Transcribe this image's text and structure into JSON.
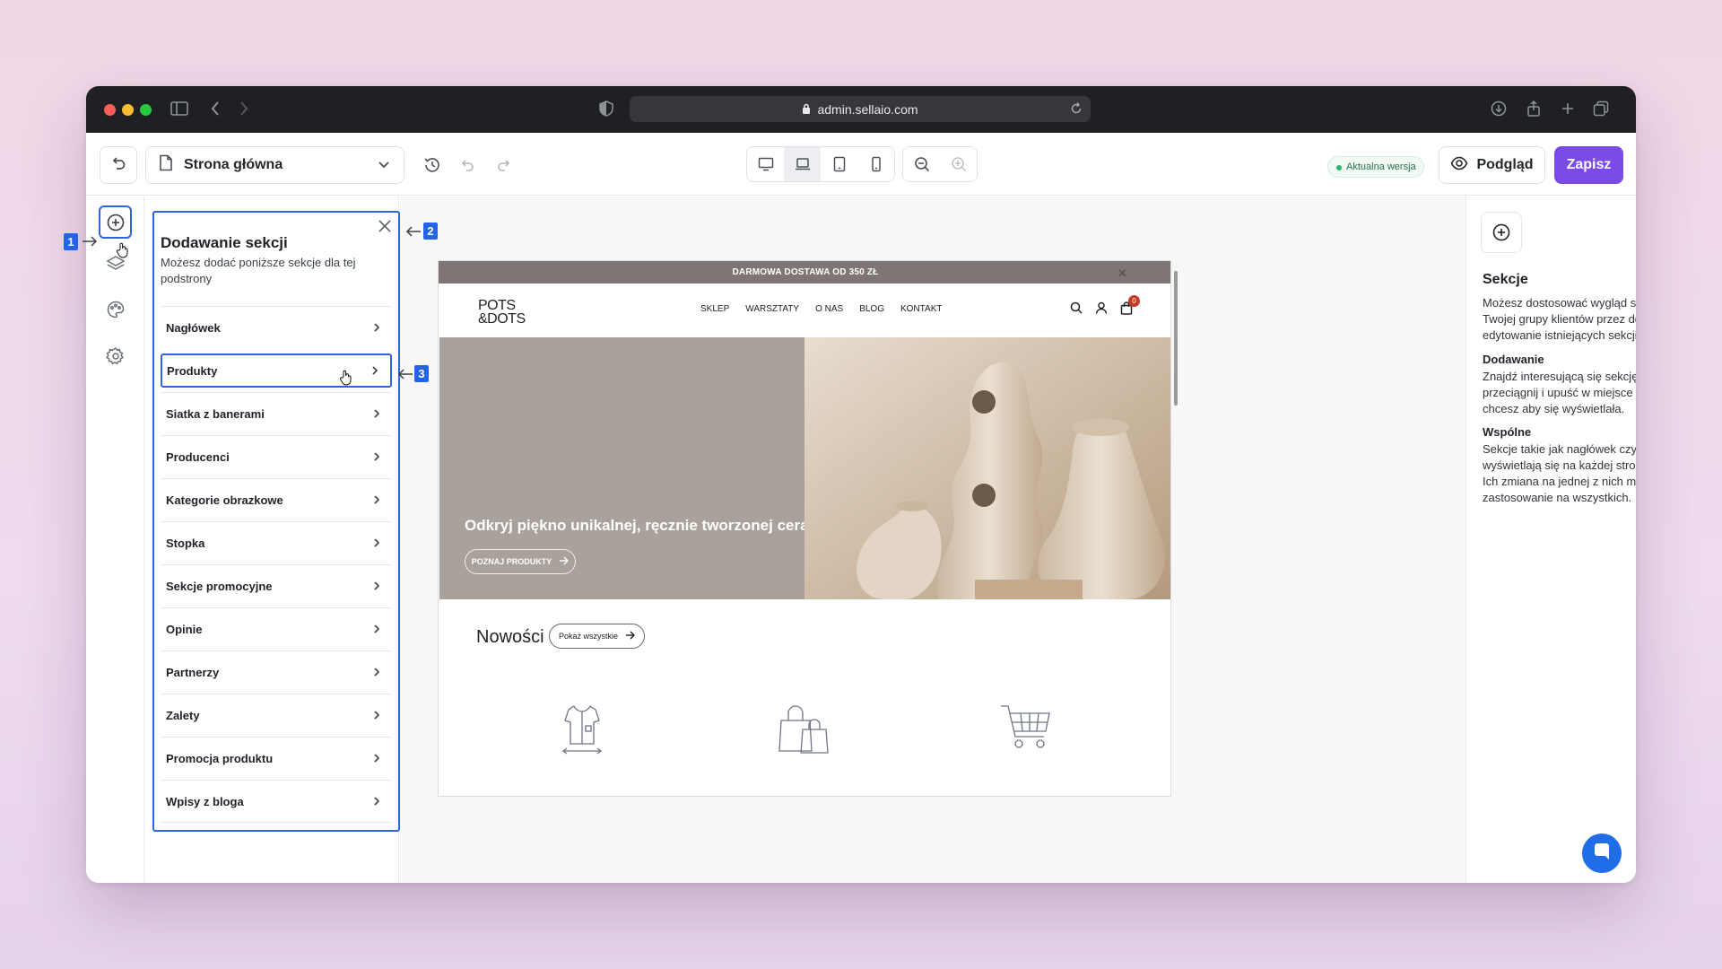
{
  "browser": {
    "url": "admin.sellaio.com"
  },
  "toolbar": {
    "page_selector": "Strona główna",
    "version_badge": "Aktualna wersja",
    "preview_label": "Podgląd",
    "save_label": "Zapisz",
    "accent_color": "#7b4be8"
  },
  "sections_panel": {
    "title": "Dodawanie sekcji",
    "subtitle": "Możesz dodać poniższe sekcje dla tej podstrony",
    "items": [
      {
        "label": "Nagłówek"
      },
      {
        "label": "Produkty"
      },
      {
        "label": "Siatka z banerami"
      },
      {
        "label": "Producenci"
      },
      {
        "label": "Kategorie obrazkowe"
      },
      {
        "label": "Stopka"
      },
      {
        "label": "Sekcje promocyjne"
      },
      {
        "label": "Opinie"
      },
      {
        "label": "Partnerzy"
      },
      {
        "label": "Zalety"
      },
      {
        "label": "Promocja produktu"
      },
      {
        "label": "Wpisy z bloga"
      }
    ]
  },
  "annotations": {
    "a1": "1",
    "a2": "2",
    "a3": "3"
  },
  "store": {
    "top_bar": "DARMOWA DOSTAWA OD 350 ZŁ",
    "logo_line1": "POTS",
    "logo_line2": "&DOTS",
    "nav": [
      "SKLEP",
      "WARSZTATY",
      "O NAS",
      "BLOG",
      "KONTAKT"
    ],
    "cart_count": "0",
    "hero_heading": "Odkryj piękno unikalnej, ręcznie tworzonej ceramiki",
    "hero_button": "POZNAJ PRODUKTY",
    "new_heading": "Nowości",
    "new_button": "Pokaż wszystkie"
  },
  "right_panel": {
    "title": "Sekcje",
    "intro": "Możesz dostosować wygląd sklepu do Twojej grupy klientów przez dodawanie i edytowanie istniejących sekcji.",
    "adding_title": "Dodawanie",
    "adding_text": "Znajdź interesującą się sekcję. Kliknij, przeciągnij i upuść w miejsce w którym chcesz aby się wyświetlała.",
    "common_title": "Wspólne",
    "common_text": "Sekcje takie jak nagłówek czy stopka wyświetlają się na każdej stronie sklepu. Ich zmiana na jednej z nich ma zastosowanie na wszystkich."
  }
}
